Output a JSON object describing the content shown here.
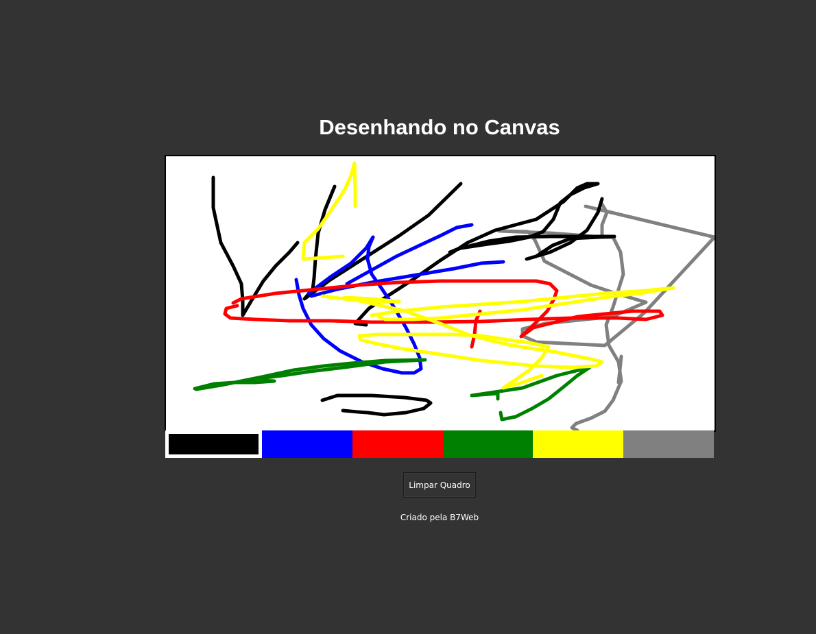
{
  "page": {
    "title": "Desenhando no Canvas",
    "background_color": "#333333"
  },
  "canvas": {
    "background_color": "#ffffff",
    "border_color": "#000000",
    "stroke_width": 5
  },
  "palette": {
    "active_color": "#000000",
    "colors": [
      {
        "name": "black",
        "hex": "#000000"
      },
      {
        "name": "blue",
        "hex": "#0000ff"
      },
      {
        "name": "red",
        "hex": "#ff0000"
      },
      {
        "name": "green",
        "hex": "#008000"
      },
      {
        "name": "yellow",
        "hex": "#ffff00"
      },
      {
        "name": "gray",
        "hex": "#808080"
      }
    ]
  },
  "clear_button": {
    "label": "Limpar Quadro"
  },
  "footer": {
    "credit": "Criado pela B7Web"
  }
}
